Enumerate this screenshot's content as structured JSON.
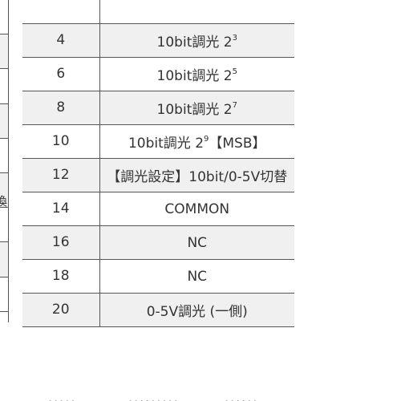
{
  "left_clipped_glyph": "換",
  "table": {
    "rows": [
      {
        "pin": "",
        "base": "",
        "sup": "",
        "suffix": ""
      },
      {
        "pin": "4",
        "base": "10bit調光 2",
        "sup": "3",
        "suffix": ""
      },
      {
        "pin": "6",
        "base": "10bit調光 2",
        "sup": "5",
        "suffix": ""
      },
      {
        "pin": "8",
        "base": "10bit調光 2",
        "sup": "7",
        "suffix": ""
      },
      {
        "pin": "10",
        "base": "10bit調光 2",
        "sup": "9",
        "suffix": "【MSB】"
      },
      {
        "pin": "12",
        "base": "【調光設定】10bit/0-5V切替",
        "sup": "",
        "suffix": ""
      },
      {
        "pin": "14",
        "base": "COMMON",
        "sup": "",
        "suffix": ""
      },
      {
        "pin": "16",
        "base": "NC",
        "sup": "",
        "suffix": ""
      },
      {
        "pin": "18",
        "base": "NC",
        "sup": "",
        "suffix": ""
      },
      {
        "pin": "20",
        "base": "0-5V調光 (一側)",
        "sup": "",
        "suffix": ""
      }
    ]
  }
}
